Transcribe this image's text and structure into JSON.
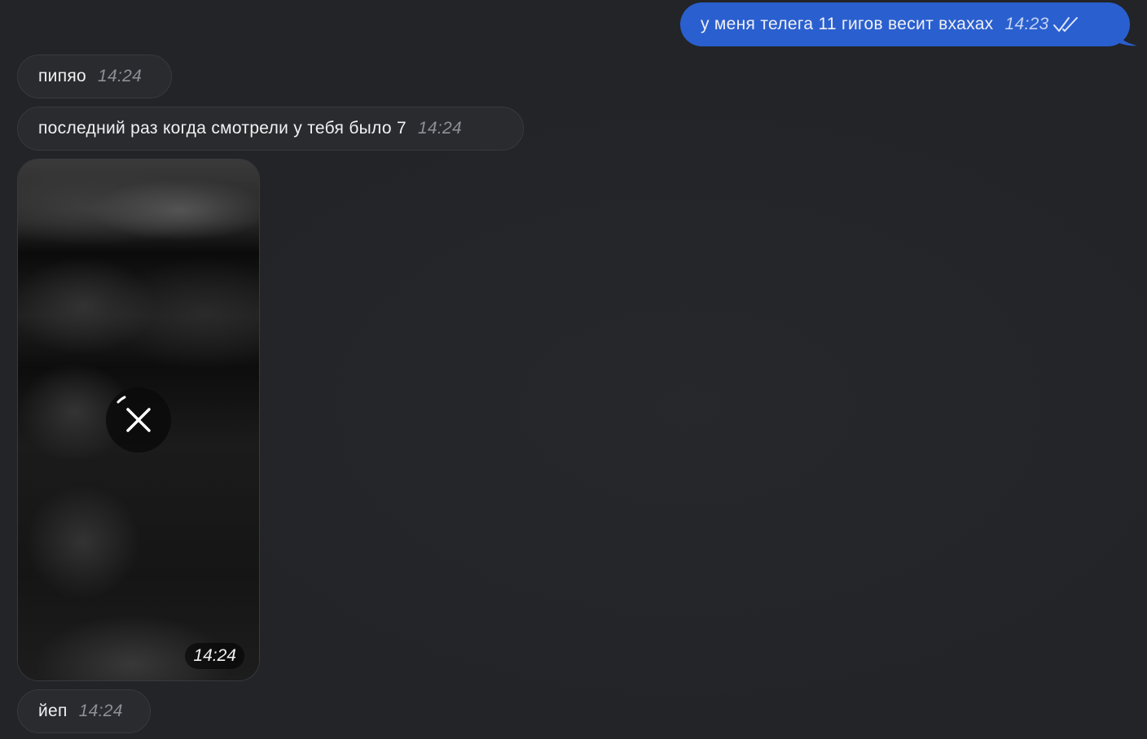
{
  "messages": [
    {
      "text": "у меня телега 11 гигов весит вхахах",
      "time": "14:23",
      "status_icon": "double-check-icon"
    },
    {
      "text": "пипяо",
      "time": "14:24"
    },
    {
      "text": "последний раз когда смотрели у тебя было 7",
      "time": "14:24"
    },
    {
      "media_time": "14:24",
      "media_state": "downloading",
      "action_icon": "close-icon"
    },
    {
      "text": "йеп",
      "time": "14:24"
    }
  ],
  "colors": {
    "background": "#222427",
    "incoming_bubble": "#2a2b2e",
    "outgoing_bubble": "#2a5fcf"
  }
}
